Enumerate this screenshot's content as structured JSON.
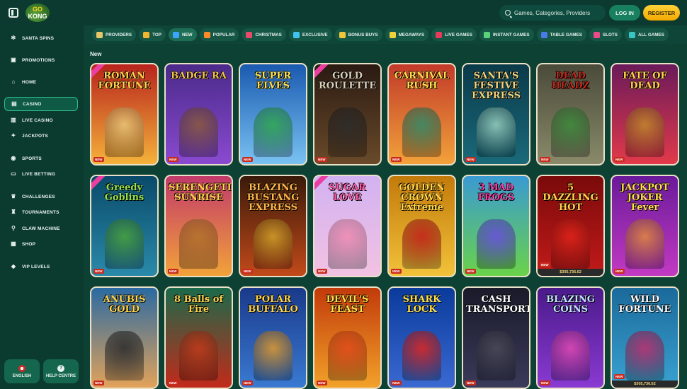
{
  "header": {
    "logo_text_top": "GO",
    "logo_text_bottom": "KONG",
    "search_placeholder": "Games, Categories, Providers",
    "login_label": "LOG IN",
    "register_label": "REGISTER"
  },
  "sidebar": {
    "items": [
      {
        "label": "SANTA SPINS",
        "icon": "snowflake-icon"
      },
      {
        "label": "PROMOTIONS",
        "icon": "gift-icon"
      },
      {
        "label": "HOME",
        "icon": "home-icon"
      },
      {
        "label": "CASINO",
        "icon": "casino-icon",
        "active": true
      },
      {
        "label": "LIVE CASINO",
        "icon": "live-casino-icon"
      },
      {
        "label": "JACKPOTS",
        "icon": "jackpot-icon"
      },
      {
        "label": "SPORTS",
        "icon": "soccer-ball-icon"
      },
      {
        "label": "LIVE BETTING",
        "icon": "live-betting-icon"
      },
      {
        "label": "CHALLENGES",
        "icon": "trophy-icon"
      },
      {
        "label": "TOURNAMENTS",
        "icon": "tournament-icon"
      },
      {
        "label": "CLAW MACHINE",
        "icon": "claw-icon"
      },
      {
        "label": "SHOP",
        "icon": "shop-icon"
      },
      {
        "label": "VIP LEVELS",
        "icon": "diamond-icon"
      }
    ],
    "language_label": "ENGLISH",
    "help_label": "HELP CENTRE"
  },
  "categories": [
    {
      "label": "PROVIDERS",
      "color": "#e8c66a"
    },
    {
      "label": "TOP",
      "color": "#f2b630"
    },
    {
      "label": "NEW",
      "color": "#3aa4ff",
      "active": true
    },
    {
      "label": "POPULAR",
      "color": "#ff8a2a"
    },
    {
      "label": "CHRISTMAS",
      "color": "#e84a6a"
    },
    {
      "label": "EXCLUSIVE",
      "color": "#3fc4f2"
    },
    {
      "label": "BONUS BUYS",
      "color": "#f2c63a"
    },
    {
      "label": "MEGAWAYS",
      "color": "#f2d23a"
    },
    {
      "label": "LIVE GAMES",
      "color": "#e83a5a"
    },
    {
      "label": "INSTANT GAMES",
      "color": "#5ad27a"
    },
    {
      "label": "TABLE GAMES",
      "color": "#4a7ae8"
    },
    {
      "label": "SLOTS",
      "color": "#e84a8a"
    },
    {
      "label": "ALL GAMES",
      "color": "#3ac4c4"
    }
  ],
  "section": {
    "title": "New"
  },
  "games": [
    {
      "title": "ROMAN FORTUNE",
      "bg": "#b8231d",
      "bg2": "#f5b23a",
      "art": "#e9c77a",
      "title_color": "#ffd44a"
    },
    {
      "title": "BADGE RA",
      "bg": "#4a2a8a",
      "bg2": "#8a4ad0",
      "art": "#8a5a3a",
      "title_color": "#f2c24a"
    },
    {
      "title": "SUPER ELVES",
      "bg": "#1a5ab0",
      "bg2": "#7ac2f2",
      "art": "#2ea84a",
      "title_color": "#ffe04a"
    },
    {
      "title": "GOLD ROULETTE",
      "bg": "#2a1a12",
      "bg2": "#6a4a2a",
      "art": "#2a2a2a",
      "title_color": "#d9d0b8"
    },
    {
      "title": "CARNIVAL RUSH",
      "bg": "#c23a2a",
      "bg2": "#f2a23a",
      "art": "#2a8a6a",
      "title_color": "#ffe04a"
    },
    {
      "title": "SANTA'S FESTIVE EXPRESS",
      "bg": "#0a3a4a",
      "bg2": "#1a6a7a",
      "art": "#9ad2c2",
      "title_color": "#f2d27a"
    },
    {
      "title": "DEAD HEADZ",
      "bg": "#4a4a3a",
      "bg2": "#8a8a6a",
      "art": "#3a8a3a",
      "title_color": "#c2261a"
    },
    {
      "title": "FATE OF DEAD",
      "bg": "#6a1a5a",
      "bg2": "#e23a4a",
      "art": "#c28a2a",
      "title_color": "#ffd44a"
    },
    {
      "title": "Greedy Goblins",
      "bg": "#0a4a6a",
      "bg2": "#2a8aaa",
      "art": "#4aa23a",
      "title_color": "#9ae24a"
    },
    {
      "title": "SERENGETI SUNRISE",
      "bg": "#c23a6a",
      "bg2": "#f2a23a",
      "art": "#b2722a",
      "title_color": "#ffd44a"
    },
    {
      "title": "BLAZING BUSTANG EXPRESS",
      "bg": "#3a1a0a",
      "bg2": "#c24a1a",
      "art": "#d2a22a",
      "title_color": "#ffb84a"
    },
    {
      "title": "SUGAR LOVE",
      "bg": "#d2b2f2",
      "bg2": "#f2c2e2",
      "art": "#f28ab2",
      "title_color": "#ff5aa2"
    },
    {
      "title": "GOLDEN CROWN Extreme",
      "bg": "#c27a0a",
      "bg2": "#f2c23a",
      "art": "#c21a1a",
      "title_color": "#ffd44a"
    },
    {
      "title": "3 MAD FROGS",
      "bg": "#3a9ad2",
      "bg2": "#6ad24a",
      "art": "#6a4ae2",
      "title_color": "#ff3aa2"
    },
    {
      "title": "5 DAZZLING HOT",
      "bg": "#7a0a0a",
      "bg2": "#c21a1a",
      "art": "#e2241a",
      "title_color": "#ffd44a",
      "jackpot": "$305,736.62"
    },
    {
      "title": "JACKPOT JOKER Fever",
      "bg": "#6a1a9a",
      "bg2": "#c23ac2",
      "art": "#e28a3a",
      "title_color": "#ffe04a"
    },
    {
      "title": "ANUBIS GOLD",
      "bg": "#2a6aa2",
      "bg2": "#e2a25a",
      "art": "#2a2a2a",
      "title_color": "#ffd44a"
    },
    {
      "title": "8 Balls of Fire",
      "bg": "#1a6a4a",
      "bg2": "#c22a1a",
      "art": "#c23a1a",
      "title_color": "#ffd44a"
    },
    {
      "title": "POLAR BUFFALO",
      "bg": "#1a3a8a",
      "bg2": "#3a7ad2",
      "art": "#e29a2a",
      "title_color": "#ffd44a"
    },
    {
      "title": "DEVIL'S FEAST",
      "bg": "#c23a0a",
      "bg2": "#f2a22a",
      "art": "#e24a1a",
      "title_color": "#ffe04a"
    },
    {
      "title": "SHARK LOCK",
      "bg": "#0a3a9a",
      "bg2": "#3a6ad2",
      "art": "#e2241a",
      "title_color": "#ffe04a"
    },
    {
      "title": "CASH TRANSPORTER",
      "bg": "#1a1a2a",
      "bg2": "#3a3a5a",
      "art": "#4a4a5a",
      "title_color": "#ffffff"
    },
    {
      "title": "BLAZING COINS",
      "bg": "#4a1a8a",
      "bg2": "#8a3ad2",
      "art": "#e24ab2",
      "title_color": "#c2e2ff"
    },
    {
      "title": "WILD FORTUNE",
      "bg": "#1a6a9a",
      "bg2": "#3aa2d2",
      "art": "#c22a6a",
      "title_color": "#ffffff",
      "jackpot": "$305,736.62"
    }
  ],
  "new_badge": "NEW"
}
